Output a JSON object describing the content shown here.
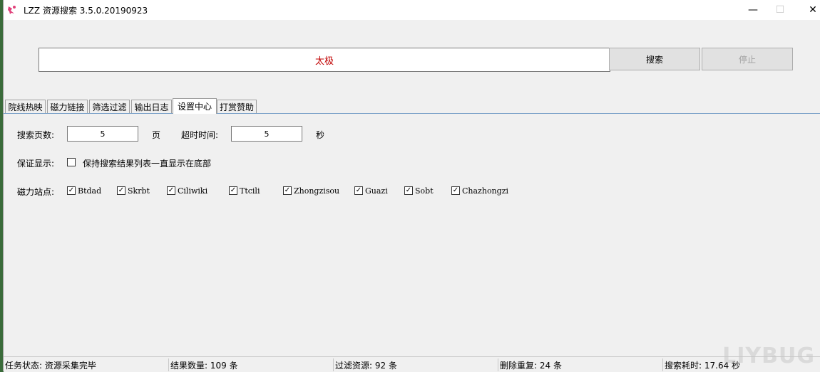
{
  "window": {
    "title": "LZZ 资源搜索 3.5.0.20190923",
    "minimize": "—",
    "maximize": "☐",
    "close": "✕"
  },
  "search": {
    "query": "太极",
    "search_label": "搜索",
    "stop_label": "停止"
  },
  "tabs": [
    {
      "label": "院线热映"
    },
    {
      "label": "磁力链接"
    },
    {
      "label": "筛选过滤"
    },
    {
      "label": "输出日志"
    },
    {
      "label": "设置中心"
    },
    {
      "label": "打赏赞助"
    }
  ],
  "settings": {
    "pages_label": "搜索页数:",
    "pages_value": "5",
    "pages_unit": "页",
    "timeout_label": "超时时间:",
    "timeout_value": "5",
    "timeout_unit": "秒",
    "ensure_label": "保证显示:",
    "ensure_option": "保持搜索结果列表一直显示在底部",
    "sites_label": "磁力站点:",
    "sites": [
      {
        "name": "Btdad",
        "checked": true
      },
      {
        "name": "Skrbt",
        "checked": true
      },
      {
        "name": "Ciliwiki",
        "checked": true
      },
      {
        "name": "Ttcili",
        "checked": true
      },
      {
        "name": "Zhongzisou",
        "checked": true
      },
      {
        "name": "Guazi",
        "checked": true
      },
      {
        "name": "Sobt",
        "checked": true
      },
      {
        "name": "Chazhongzi",
        "checked": true
      }
    ]
  },
  "status": {
    "task": "任务状态: 资源采集完毕",
    "results": "结果数量: 109 条",
    "filtered": "过滤资源: 92 条",
    "duplicates": "删除重复: 24 条",
    "time": "搜索耗时: 17.64 秒"
  },
  "watermark": "LIYBUG",
  "colors": {
    "query_text": "#c00000",
    "active_tab_line": "#7aa0c8"
  }
}
